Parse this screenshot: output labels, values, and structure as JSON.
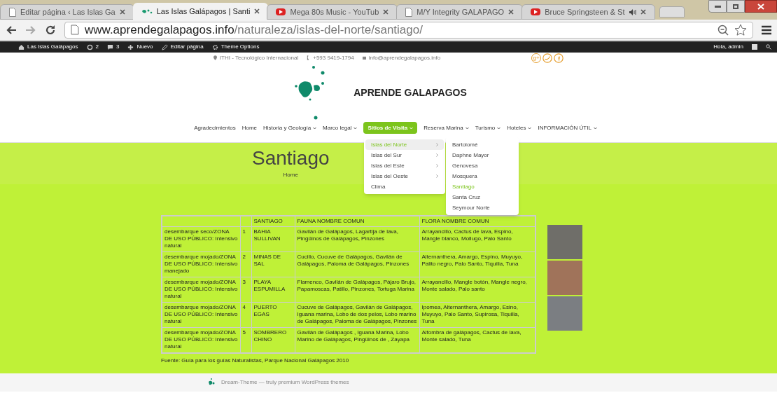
{
  "browser": {
    "tabs": [
      {
        "kind": "page",
        "title": "Editar página ‹ Las Islas Ga",
        "selected": false
      },
      {
        "kind": "site",
        "title": "Las Islas Galápagos | Santi",
        "selected": true
      },
      {
        "kind": "video",
        "title": "Mega 80s Music - YouTub",
        "selected": false
      },
      {
        "kind": "page",
        "title": "M/Y Integrity GALAPAGO",
        "selected": false
      },
      {
        "kind": "video",
        "title": "Bruce Springsteen & St",
        "selected": false,
        "audio": true
      }
    ],
    "url_host": "www.aprendegalapagos.info",
    "url_path": "/naturaleza/islas-del-norte/santiago/"
  },
  "admin_bar": {
    "items": [
      {
        "kind": "home",
        "label": "Las Islas Galápagos"
      },
      {
        "kind": "updates",
        "label": "2"
      },
      {
        "kind": "comments",
        "label": "3"
      },
      {
        "kind": "new",
        "label": "Nuevo"
      },
      {
        "kind": "edit",
        "label": "Editar página"
      },
      {
        "kind": "gear",
        "label": "Theme Options"
      }
    ],
    "greeting": "Hola, admin"
  },
  "contact": [
    {
      "kind": "pin",
      "label": "ITHI - Tecnológico Internacional"
    },
    {
      "kind": "phone",
      "label": "+593 9419-1794"
    },
    {
      "kind": "mail",
      "label": "info@aprendegalapagos.info"
    }
  ],
  "social": [
    {
      "kind": "google_plus",
      "label": "g+"
    },
    {
      "kind": "twitter"
    },
    {
      "kind": "facebook"
    }
  ],
  "site_title": "APRENDE GALAPAGOS",
  "nav": [
    {
      "label": "Agradecimientos",
      "has_menu": false,
      "selected": false
    },
    {
      "label": "Home",
      "has_menu": false,
      "selected": false
    },
    {
      "label": "Historia y Geología",
      "has_menu": true,
      "selected": false
    },
    {
      "label": "Marco legal",
      "has_menu": true,
      "selected": false
    },
    {
      "label": "Sitios de Visita",
      "has_menu": true,
      "selected": true
    },
    {
      "label": "Reserva Marina",
      "has_menu": true,
      "selected": false
    },
    {
      "label": "Turismo",
      "has_menu": true,
      "selected": false
    },
    {
      "label": "Hoteles",
      "has_menu": true,
      "selected": false
    },
    {
      "label": "INFORMACIÓN ÚTIL",
      "has_menu": true,
      "selected": false
    }
  ],
  "dropdown": [
    {
      "label": "Islas del Norte",
      "has_menu": true,
      "selected": true
    },
    {
      "label": "Islas del Sur",
      "has_menu": true,
      "selected": false
    },
    {
      "label": "Islas del Este",
      "has_menu": true,
      "selected": false
    },
    {
      "label": "Islas del Oeste",
      "has_menu": true,
      "selected": false
    },
    {
      "label": "Clima",
      "has_menu": false,
      "selected": false
    }
  ],
  "submenu": [
    {
      "label": "Bartolomé",
      "selected": false
    },
    {
      "label": "Daphne Mayor",
      "selected": false
    },
    {
      "label": "Genovesa",
      "selected": false
    },
    {
      "label": "Mosquera",
      "selected": false
    },
    {
      "label": "Santiago",
      "selected": true
    },
    {
      "label": "Santa Cruz",
      "selected": false
    },
    {
      "label": "Seymour Norte",
      "selected": false
    }
  ],
  "page_title": "Santiago",
  "breadcrumb": [
    "Home"
  ],
  "table": {
    "columns": [
      "",
      "",
      "SANTIAGO",
      "FAUNA NOMBRE COMUN",
      "FLORA NOMBRE COMUN"
    ],
    "rows": [
      [
        "desembarque seco/ZONA DE USO PÚBLICO: Intensivo natural",
        "1",
        "BAHIA SULLIVAN",
        "Gavilán de Galápagos, Lagartija de lava, Pingüinos de Galápagos, Pinzones",
        "Arrayancillo, Cactus de lava, Espino, Mangle blanco, Mollugo, Palo Santo"
      ],
      [
        "desembarque mojado/ZONA DE USO PÚBLICO: Intensivo manejado",
        "2",
        "MINAS DE SAL",
        "Cucillo, Cucuve de Galápagos, Gavilán de Galápagos, Paloma de Galápagos, Pinzones",
        "Alternanthera, Amargo, Espino, Muyuyo, Palito negro, Palo Santo, Tiquilia, Tuna"
      ],
      [
        "desembarque mojado/ZONA DE USO PÚBLICO: Intensivo natural",
        "3",
        "PLAYA ESPUMILLA",
        "Flamenco, Gavilán de Galápagos, Pájaro Brujo, Papamoscas, Patillo, Pinzones, Tortuga Marina",
        "Arrayancillo, Mangle botón, Mangle negro, Monte salado, Palo santo"
      ],
      [
        "desembarque mojado/ZONA DE USO PÚBLICO: Intensivo natural",
        "4",
        "PUERTO EGAS",
        "Cucuve de Galápagos, Gavilán de Galápagos, Iguana marina, Lobo de dos pelos, Lobo marino de Galápagos, Paloma de Galápagos, Pinzones",
        "Ipomea, Alternanthera, Amargo, Esino, Muyuyo, Palo Santo, Supirosa, Tiquilla, Tuna"
      ],
      [
        "desembarque mojado/ZONA DE USO PÚBLICO: Intensivo natural",
        "5",
        "SOMBRERO CHINO",
        "Gavilán de Galápagos , Iguana Marina, Lobo Marino de Galápagos, Pingüinos de , Zayapa",
        "Alfombra de galápagos, Cactus de lava, Monte salado, Tuna"
      ]
    ]
  },
  "source": "Fuente: Guía para los guías Naturalistas, Parque Nacional Galápagos 2010",
  "footer": "Dream-Theme — truly premium WordPress themes"
}
